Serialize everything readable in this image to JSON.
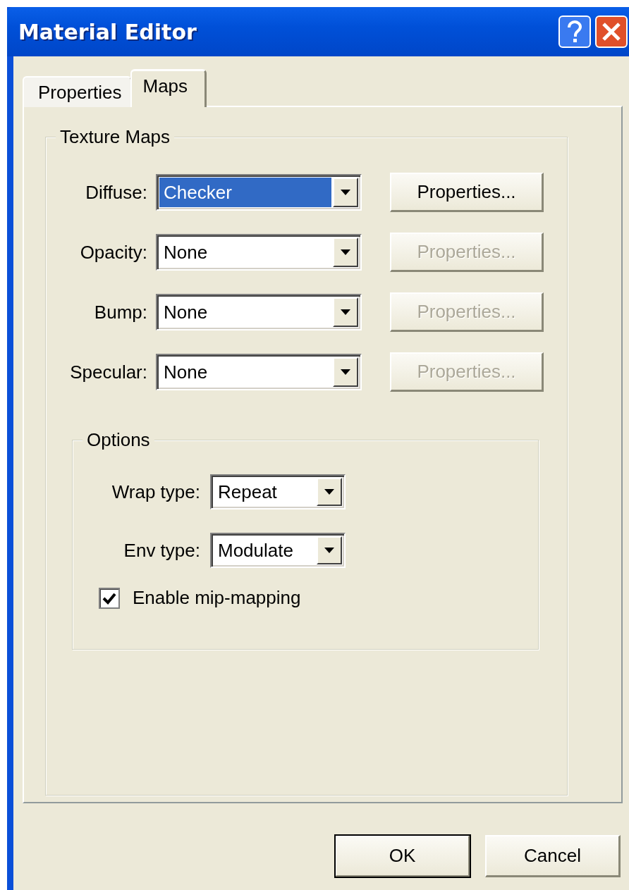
{
  "window": {
    "title": "Material Editor"
  },
  "tabs": [
    {
      "label": "Properties",
      "selected": false
    },
    {
      "label": "Maps",
      "selected": true
    }
  ],
  "texture_maps": {
    "title": "Texture Maps",
    "rows": [
      {
        "label": "Diffuse:",
        "value": "Checker",
        "focused": true,
        "button": {
          "label": "Properties...",
          "disabled": false
        }
      },
      {
        "label": "Opacity:",
        "value": "None",
        "focused": false,
        "button": {
          "label": "Properties...",
          "disabled": true
        }
      },
      {
        "label": "Bump:",
        "value": "None",
        "focused": false,
        "button": {
          "label": "Properties...",
          "disabled": true
        }
      },
      {
        "label": "Specular:",
        "value": "None",
        "focused": false,
        "button": {
          "label": "Properties...",
          "disabled": true
        }
      }
    ]
  },
  "options": {
    "title": "Options",
    "dropdowns": [
      {
        "label": "Wrap type:",
        "value": "Repeat"
      },
      {
        "label": "Env type:",
        "value": "Modulate"
      }
    ],
    "checkbox": {
      "label": "Enable mip-mapping",
      "checked": true
    }
  },
  "buttons": [
    {
      "label": "OK",
      "default": true
    },
    {
      "label": "Cancel",
      "default": false
    }
  ]
}
